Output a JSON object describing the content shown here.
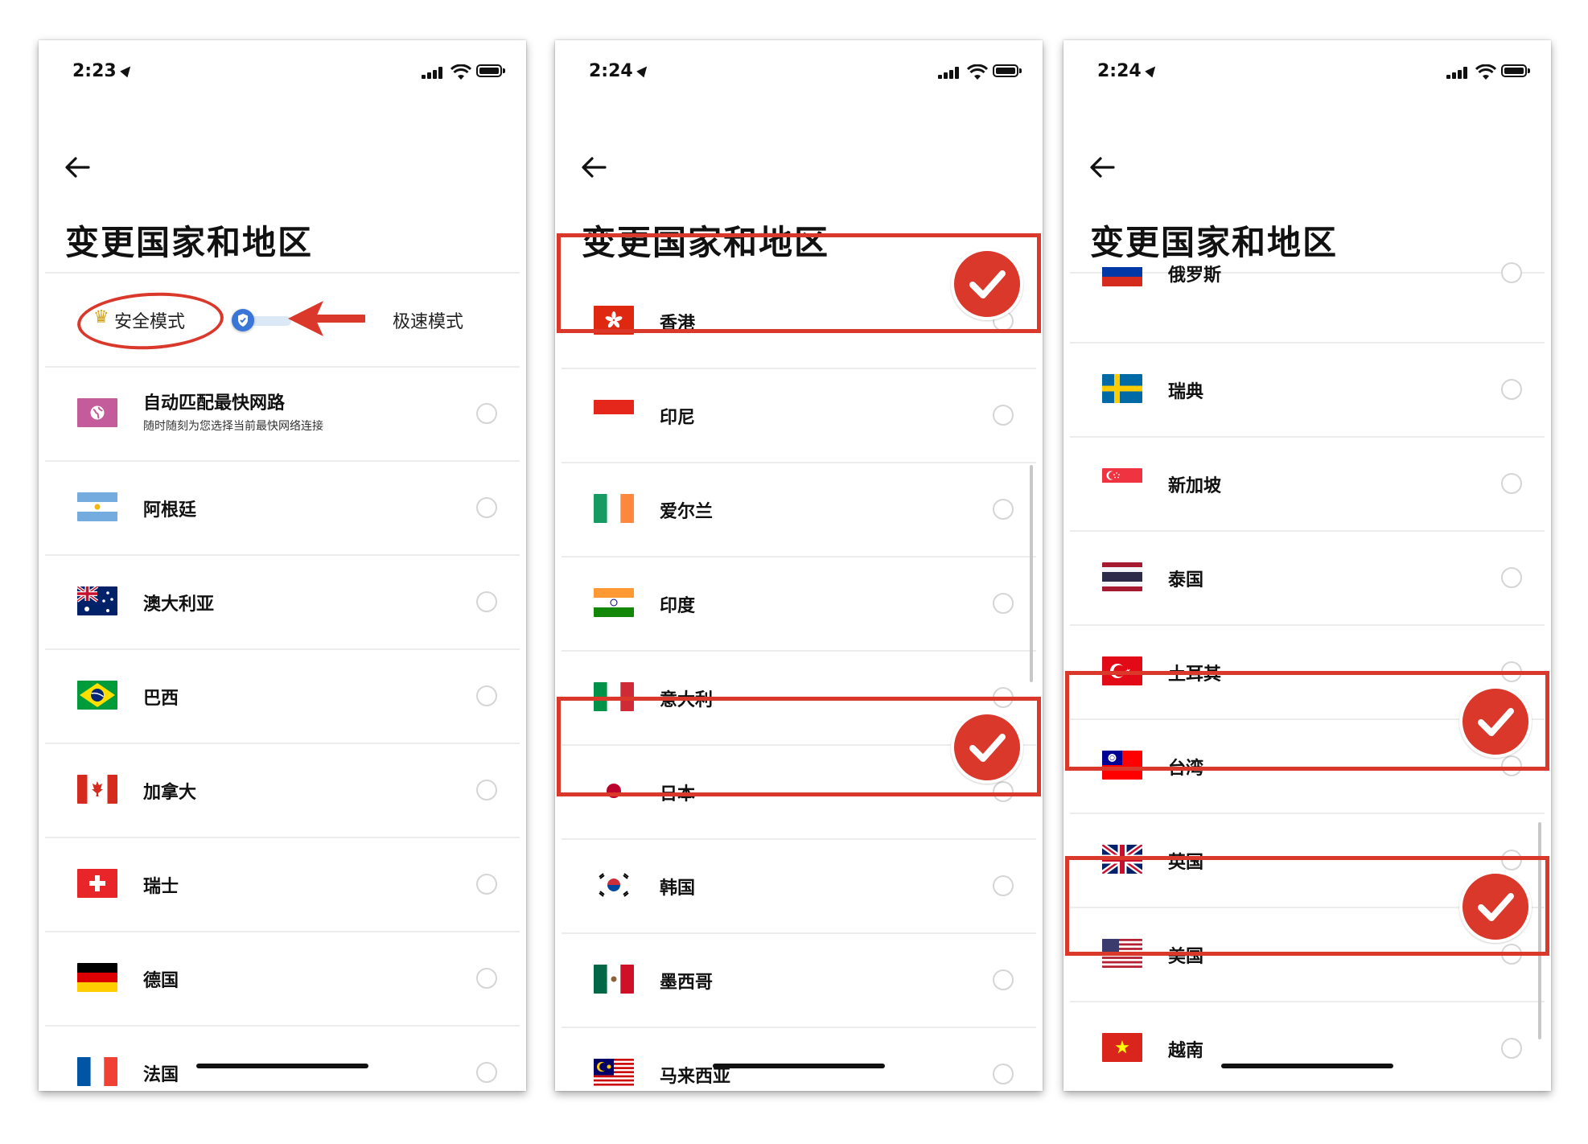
{
  "colors": {
    "annotation_red": "#d9382b",
    "toggle_blue": "#3a76d8",
    "divider": "#ececec"
  },
  "screens": [
    {
      "time": "2:23",
      "title": "变更国家和地区",
      "mode": {
        "crown_icon": "crown-icon",
        "safe_label": "安全模式",
        "fast_label": "极速模式",
        "toggle_icon": "shield-icon"
      },
      "items": [
        {
          "label": "自动匹配最快网路",
          "sub": "随时随刻为您选择当前最快网络连接",
          "flag": "globe-icon",
          "selected": false
        },
        {
          "label": "阿根廷",
          "flag": "argentina",
          "selected": false
        },
        {
          "label": "澳大利亚",
          "flag": "australia",
          "selected": false
        },
        {
          "label": "巴西",
          "flag": "brazil",
          "selected": false
        },
        {
          "label": "加拿大",
          "flag": "canada",
          "selected": false
        },
        {
          "label": "瑞士",
          "flag": "switzerland",
          "selected": false
        },
        {
          "label": "德国",
          "flag": "germany",
          "selected": false
        },
        {
          "label": "法国",
          "flag": "france",
          "selected": false
        }
      ]
    },
    {
      "time": "2:24",
      "title": "变更国家和地区",
      "items": [
        {
          "label": "香港",
          "flag": "hongkong",
          "selected": true
        },
        {
          "label": "印尼",
          "flag": "indonesia",
          "selected": false
        },
        {
          "label": "爱尔兰",
          "flag": "ireland",
          "selected": false
        },
        {
          "label": "印度",
          "flag": "india",
          "selected": false
        },
        {
          "label": "意大利",
          "flag": "italy",
          "selected": false
        },
        {
          "label": "日本",
          "flag": "japan",
          "selected": true
        },
        {
          "label": "韩国",
          "flag": "korea",
          "selected": false
        },
        {
          "label": "墨西哥",
          "flag": "mexico",
          "selected": false
        },
        {
          "label": "马来西亚",
          "flag": "malaysia",
          "selected": false
        }
      ]
    },
    {
      "time": "2:24",
      "title": "变更国家和地区",
      "items": [
        {
          "label": "俄罗斯",
          "flag": "russia",
          "selected": false
        },
        {
          "label": "瑞典",
          "flag": "sweden",
          "selected": false
        },
        {
          "label": "新加坡",
          "flag": "singapore",
          "selected": false
        },
        {
          "label": "泰国",
          "flag": "thailand",
          "selected": false
        },
        {
          "label": "土耳其",
          "flag": "turkey",
          "selected": false
        },
        {
          "label": "台湾",
          "flag": "taiwan",
          "selected": true
        },
        {
          "label": "英国",
          "flag": "uk",
          "selected": false
        },
        {
          "label": "美国",
          "flag": "usa",
          "selected": true
        },
        {
          "label": "越南",
          "flag": "vietnam",
          "selected": false
        }
      ]
    }
  ]
}
